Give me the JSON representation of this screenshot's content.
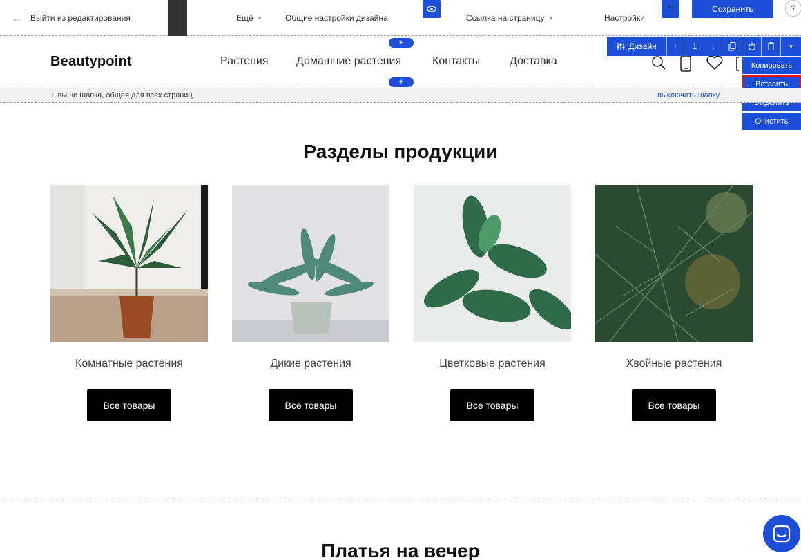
{
  "editor": {
    "exit_label": "Выйти из редактирования",
    "more_label": "Ещё",
    "design_settings_label": "Общие настройки дизайна",
    "page_link_label": "Ссылка на страницу",
    "settings_label": "Настройки",
    "save_label": "Сохранить",
    "help_label": "?"
  },
  "site": {
    "logo": "Beautypoint",
    "nav": [
      "Растения",
      "Домашние растения",
      "Контакты",
      "Доставка"
    ]
  },
  "block_toolbar": {
    "design_label": "Дизайн",
    "position_value": "1"
  },
  "context_menu": {
    "items": [
      "Копировать",
      "Вставить",
      "Выделить",
      "Очистить"
    ],
    "selected": "Вставить"
  },
  "header_strip": {
    "note": "выше шапка, общая для всех страниц",
    "disable_label": "выключить шапку"
  },
  "section": {
    "title": "Разделы продукции",
    "cards": [
      {
        "caption": "Комнатные растения",
        "button": "Все товары"
      },
      {
        "caption": "Дикие растения",
        "button": "Все товары"
      },
      {
        "caption": "Цветковые растения",
        "button": "Все товары"
      },
      {
        "caption": "Хвойные растения",
        "button": "Все товары"
      }
    ]
  },
  "next_section": {
    "title": "Платья на вечер"
  },
  "colors": {
    "accent": "#1d4ed8",
    "button_bg": "#000000",
    "selection_outline": "#ee1111"
  }
}
